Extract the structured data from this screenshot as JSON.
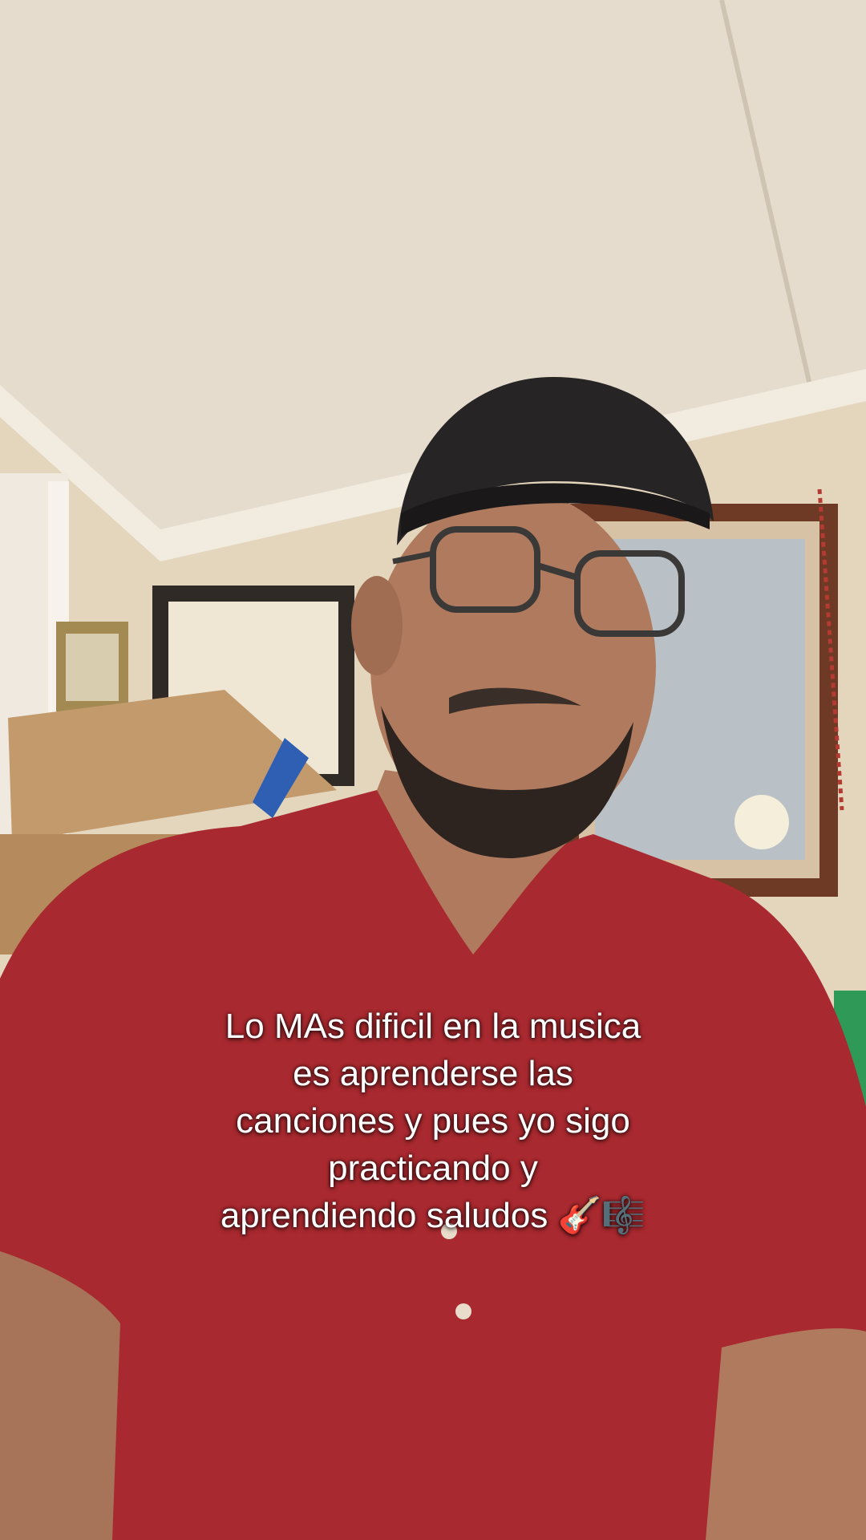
{
  "video": {
    "caption_lines": [
      "Lo MAs dificil en la musica",
      "es aprenderse las",
      "canciones y pues yo sigo",
      "practicando y",
      "aprendiendo saludos 🎸🎼"
    ],
    "colors": {
      "ceiling": "#e6dccd",
      "wall": "#e4d6bd",
      "shirt": "#a8292f",
      "cap": "#262424",
      "skin": "#b07a5e",
      "box": "#c39a6c",
      "frame_wood": "#6e3a26"
    }
  }
}
